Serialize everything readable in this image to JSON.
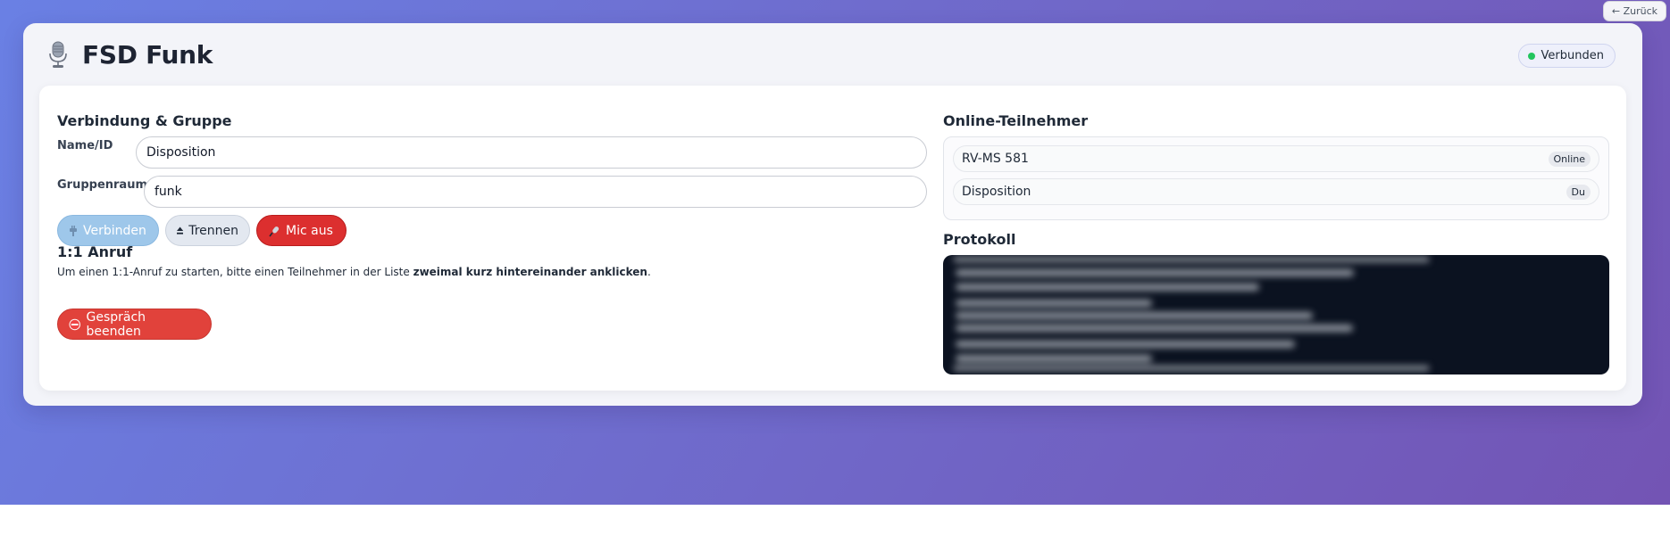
{
  "nav": {
    "back_label": "← Zurück"
  },
  "header": {
    "title": "FSD Funk",
    "status": {
      "label": "Verbunden",
      "color": "#22c55e"
    }
  },
  "connection": {
    "section_title": "Verbindung & Gruppe",
    "name": {
      "label": "Name/ID",
      "value": "Disposition"
    },
    "group": {
      "label": "Gruppenraum",
      "value": "funk"
    },
    "buttons": {
      "connect": "Verbinden",
      "disconnect": "Trennen",
      "mic": "Mic aus"
    }
  },
  "call": {
    "section_title": "1:1 Anruf",
    "hint_prefix": "Um einen 1:1-Anruf zu starten, bitte einen Teilnehmer in der Liste ",
    "hint_bold": "zweimal kurz hintereinander anklicken",
    "hint_suffix": ".",
    "end_button": "Gespräch beenden"
  },
  "participants": {
    "section_title": "Online-Teilnehmer",
    "items": [
      {
        "name": "RV-MS 581",
        "badge": "Online"
      },
      {
        "name": "Disposition",
        "badge": "Du"
      }
    ]
  },
  "log": {
    "section_title": "Protokoll"
  },
  "colors": {
    "accent_red": "#dc2f2f",
    "connect_blue": "#9ec7ea",
    "log_bg": "#0b1220"
  },
  "icons": {
    "header": "microphone-icon",
    "connect": "plug-icon",
    "disconnect": "eject-icon",
    "mic": "microphone-off-icon",
    "end_call": "no-entry-icon"
  }
}
